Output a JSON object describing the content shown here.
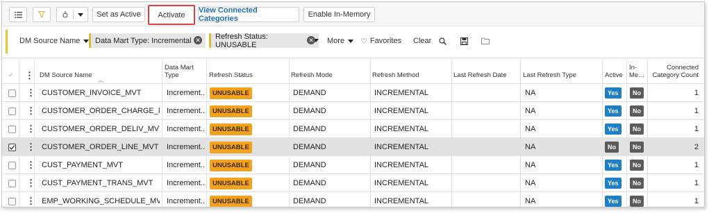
{
  "toolbar": {
    "active_label": "Set as Active",
    "activate_label": "Activate",
    "view_connected_label": "View Connected Categories",
    "enable_inmemory_label": "Enable In-Memory"
  },
  "filters": {
    "field_label": "DM Source Name",
    "chips": [
      {
        "label": "Data Mart Type: Incremental"
      },
      {
        "label": "Refresh Status: UNUSABLE"
      }
    ],
    "more_label": "More",
    "favorites_label": "Favorites",
    "clear_label": "Clear"
  },
  "table": {
    "columns": {
      "name": "DM Source Name",
      "type": "Data Mart Type",
      "status": "Refresh Status",
      "mode": "Refresh Mode",
      "method": "Refresh Method",
      "last_date": "Last Refresh Date",
      "last_type": "Last Refresh Type",
      "active": "Active",
      "inmem": "In-Me...",
      "count": "Connected Category Count"
    },
    "rows": [
      {
        "name": "CUSTOMER_INVOICE_MVT",
        "type": "Increment...",
        "status": "UNUSABLE",
        "mode": "DEMAND",
        "method": "INCREMENTAL",
        "last_date": "",
        "last_type": "NA",
        "active": "Yes",
        "inmem": "No",
        "count": "1"
      },
      {
        "name": "CUSTOMER_ORDER_CHARGE_MVT",
        "type": "Increment...",
        "status": "UNUSABLE",
        "mode": "DEMAND",
        "method": "INCREMENTAL",
        "last_date": "",
        "last_type": "NA",
        "active": "Yes",
        "inmem": "No",
        "count": "1"
      },
      {
        "name": "CUSTOMER_ORDER_DELIV_MVT",
        "type": "Increment...",
        "status": "UNUSABLE",
        "mode": "DEMAND",
        "method": "INCREMENTAL",
        "last_date": "",
        "last_type": "NA",
        "active": "Yes",
        "inmem": "No",
        "count": "1"
      },
      {
        "name": "CUSTOMER_ORDER_LINE_MVT",
        "type": "Increment...",
        "status": "UNUSABLE",
        "mode": "DEMAND",
        "method": "INCREMENTAL",
        "last_date": "",
        "last_type": "NA",
        "active": "No",
        "inmem": "No",
        "count": "2",
        "selected": true
      },
      {
        "name": "CUST_PAYMENT_MVT",
        "type": "Increment...",
        "status": "UNUSABLE",
        "mode": "DEMAND",
        "method": "INCREMENTAL",
        "last_date": "",
        "last_type": "NA",
        "active": "Yes",
        "inmem": "No",
        "count": "1"
      },
      {
        "name": "CUST_PAYMENT_TRANS_MVT",
        "type": "Increment...",
        "status": "UNUSABLE",
        "mode": "DEMAND",
        "method": "INCREMENTAL",
        "last_date": "",
        "last_type": "NA",
        "active": "Yes",
        "inmem": "No",
        "count": "1"
      },
      {
        "name": "EMP_WORKING_SCHEDULE_MVT",
        "type": "Increment...",
        "status": "UNUSABLE",
        "mode": "DEMAND",
        "method": "INCREMENTAL",
        "last_date": "",
        "last_type": "NA",
        "active": "Yes",
        "inmem": "No",
        "count": "1"
      }
    ]
  },
  "colors": {
    "accent": "#1f6fb5",
    "unusable": "#f4a21d",
    "yes": "#1e7fc6",
    "no": "#5b5b5b",
    "highlight_border": "#e0403c"
  },
  "icons": [
    "list-icon",
    "filter-icon",
    "group-icon",
    "dropdown-caret-icon",
    "heart-icon",
    "search-icon",
    "save-icon",
    "folder-icon",
    "sort-indicator-icon",
    "row-menu-icon",
    "checkbox-icon"
  ]
}
